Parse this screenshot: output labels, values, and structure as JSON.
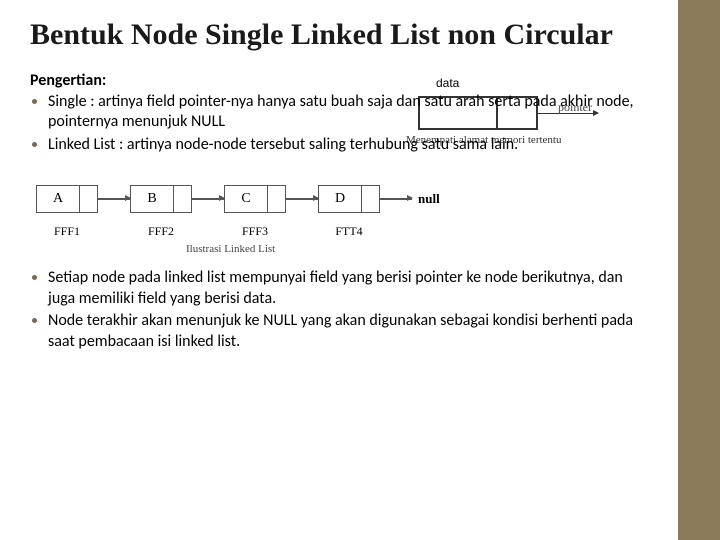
{
  "title": "Bentuk Node Single Linked List non Circular",
  "subhead": "Pengertian:",
  "bullets_top": [
    "Single : artinya field pointer-nya hanya satu buah saja dan satu arah serta pada akhir node, pointernya menunjuk NULL",
    "Linked List : artinya node-node tersebut saling terhubung satu sama lain."
  ],
  "bullets_bottom": [
    "Setiap node pada linked list mempunyai field yang berisi pointer ke node berikutnya, dan juga memiliki field yang berisi data.",
    "Node terakhir akan menunjuk ke NULL yang akan digunakan sebagai kondisi berhenti pada saat pembacaan isi linked list."
  ],
  "node_diagram": {
    "data_label": "data",
    "pointer_label": "pointer",
    "memo": "Menempati alamat memori tertentu"
  },
  "linked_list": {
    "nodes": [
      "A",
      "B",
      "C",
      "D"
    ],
    "addresses": [
      "FFF1",
      "FFF2",
      "FFF3",
      "FTT4"
    ],
    "terminal": "null",
    "caption": "Ilustrasi Linked List"
  }
}
